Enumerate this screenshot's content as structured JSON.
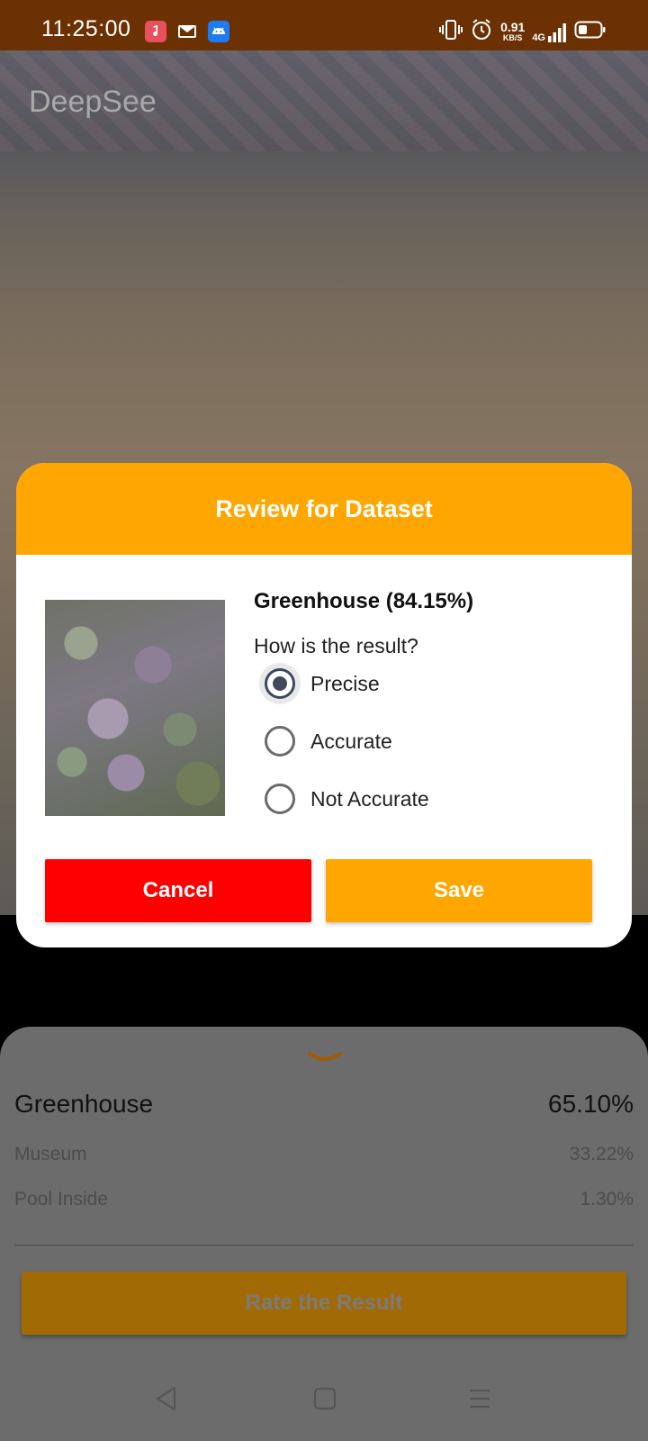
{
  "status_bar": {
    "time": "11:25:00",
    "net_speed_value": "0.91",
    "net_speed_unit": "KB/S",
    "network_type": "4G",
    "icons": [
      "music-notification-icon",
      "mail-notification-icon",
      "android-notification-icon",
      "vibrate-icon",
      "alarm-icon",
      "signal-icon",
      "battery-icon"
    ]
  },
  "app": {
    "title": "DeepSee"
  },
  "dialog": {
    "title": "Review for Dataset",
    "result_label": "Greenhouse (84.15%)",
    "question": "How is the result?",
    "options": [
      {
        "label": "Precise",
        "selected": true
      },
      {
        "label": "Accurate",
        "selected": false
      },
      {
        "label": "Not Accurate",
        "selected": false
      }
    ],
    "cancel_label": "Cancel",
    "save_label": "Save",
    "colors": {
      "header": "#ffa600",
      "cancel": "#ff0000",
      "save": "#ffa600"
    }
  },
  "sheet": {
    "predictions": [
      {
        "label": "Greenhouse",
        "value": "65.10%"
      },
      {
        "label": "Museum",
        "value": "33.22%"
      },
      {
        "label": "Pool Inside",
        "value": "1.30%"
      }
    ],
    "rate_button_label": "Rate the Result"
  },
  "nav": {
    "icons": [
      "back-icon",
      "home-icon",
      "menu-icon"
    ]
  }
}
